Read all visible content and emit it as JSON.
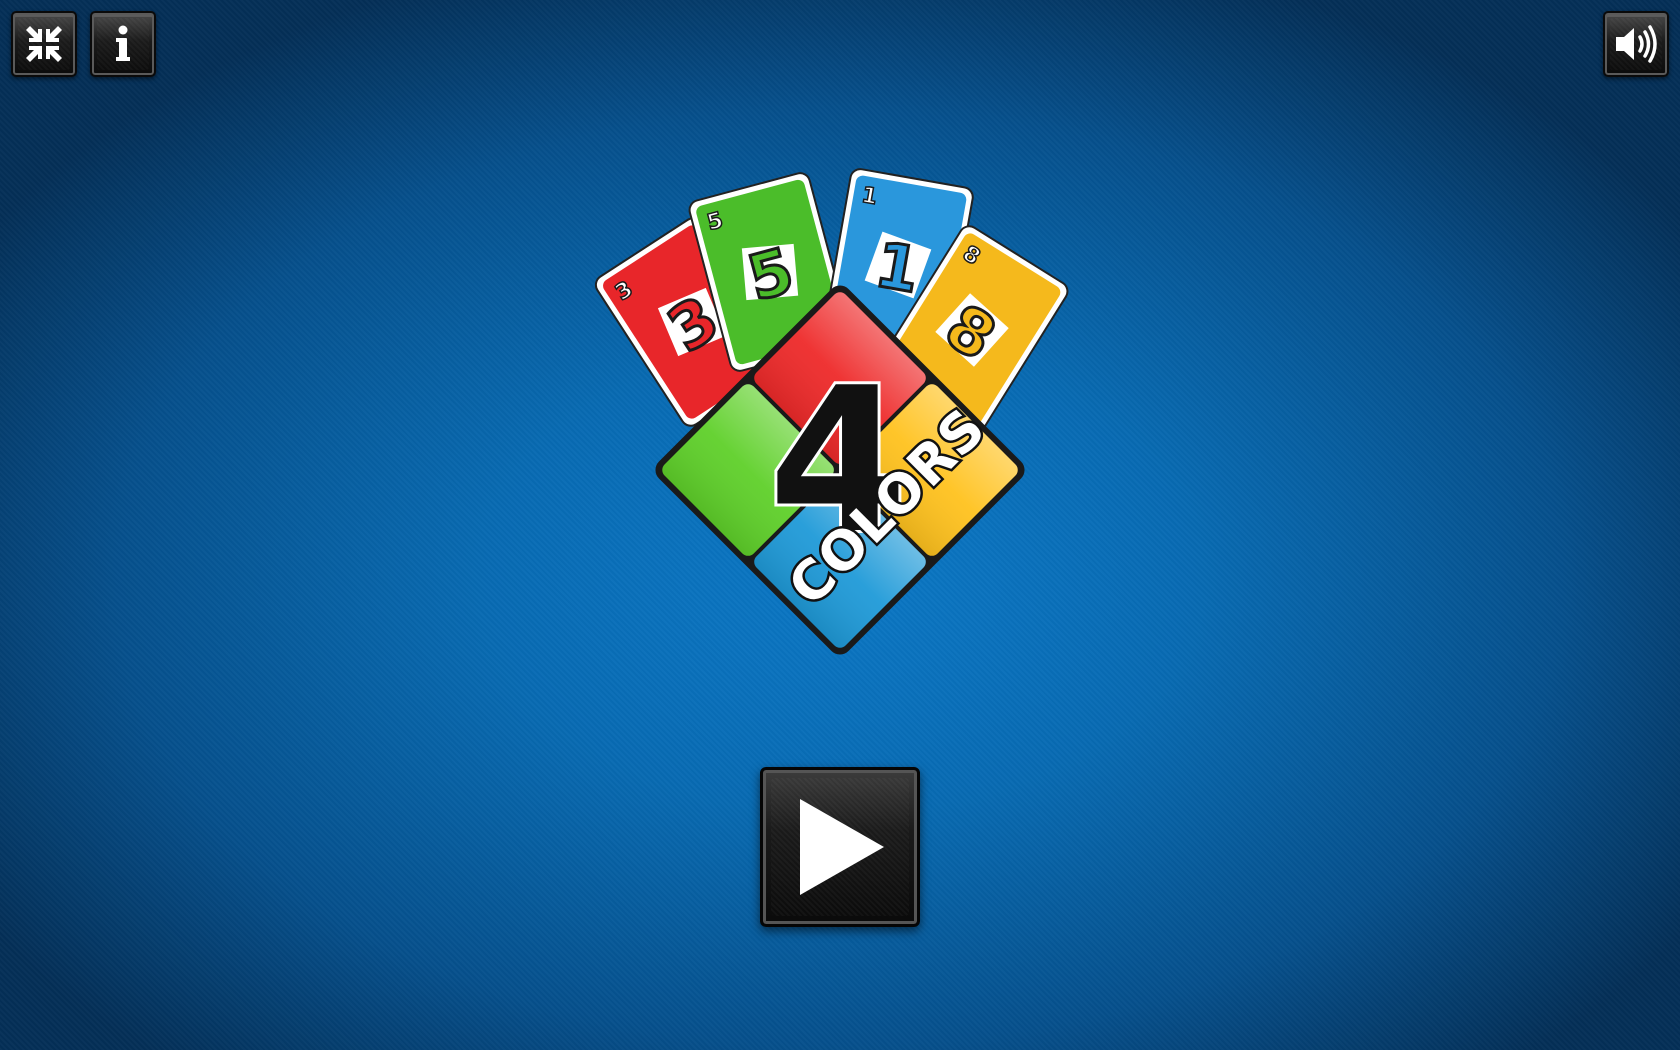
{
  "toolbar": {
    "fullscreen_icon": "collapse-arrows-icon",
    "info_icon": "info-icon",
    "sound_icon": "speaker-volume-icon"
  },
  "logo": {
    "title_number": "4",
    "title_word": "COLORS",
    "cards": [
      {
        "value": "3",
        "color": "#e8262a"
      },
      {
        "value": "5",
        "color": "#4bbd2a"
      },
      {
        "value": "1",
        "color": "#2a97dc"
      },
      {
        "value": "8",
        "color": "#f5b91c"
      }
    ],
    "tile_colors": {
      "top": "#ee2a2a",
      "left": "#5fd02a",
      "right": "#ffc21e",
      "bottom": "#1f9ad8"
    }
  },
  "play_button": {
    "icon": "play-triangle-icon"
  },
  "colors": {
    "background": "#086bb3",
    "button": "#1b1b1b"
  }
}
